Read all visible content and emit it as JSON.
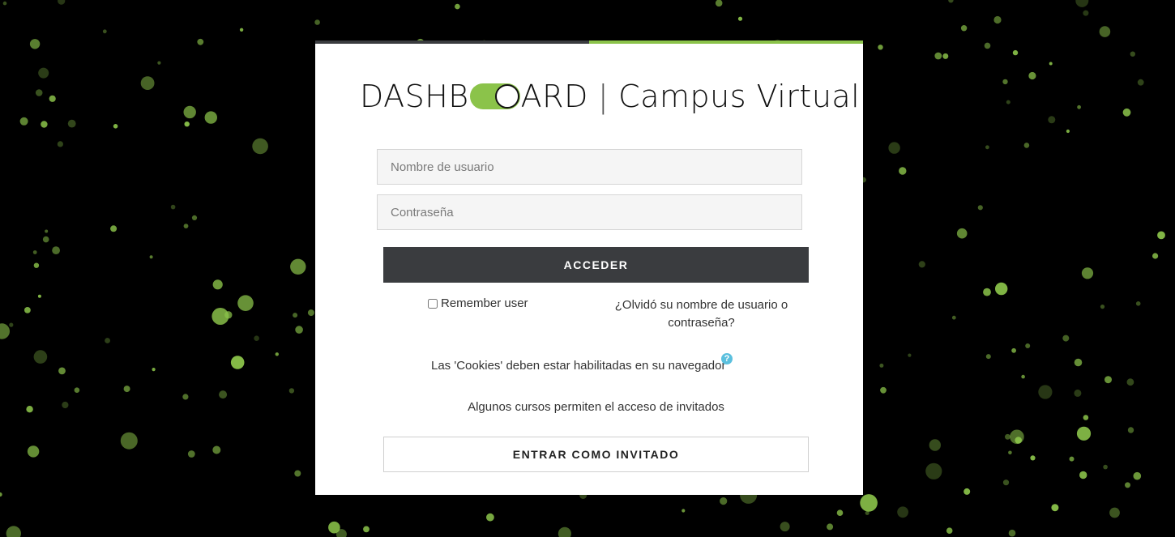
{
  "colors": {
    "background": "#000000",
    "accent_green": "#8bc34a",
    "dark_button": "#3a3c3f",
    "help_icon": "#5bc0de"
  },
  "logo": {
    "brand_before": "DASHB",
    "brand_after": "ARD",
    "separator": "|",
    "subtitle": "Campus Virtual"
  },
  "form": {
    "username_placeholder": "Nombre de usuario",
    "password_placeholder": "Contraseña",
    "login_button": "ACCEDER",
    "remember_label": "Remember user",
    "forgot_link": "¿Olvidó su nombre de usuario o contraseña?"
  },
  "notices": {
    "cookies": "Las 'Cookies' deben estar habilitadas en su navegador",
    "help_icon": "question-circle-icon",
    "help_symbol": "?",
    "guest_note": "Algunos cursos permiten el acceso de invitados"
  },
  "guest": {
    "button": "ENTRAR COMO INVITADO"
  }
}
